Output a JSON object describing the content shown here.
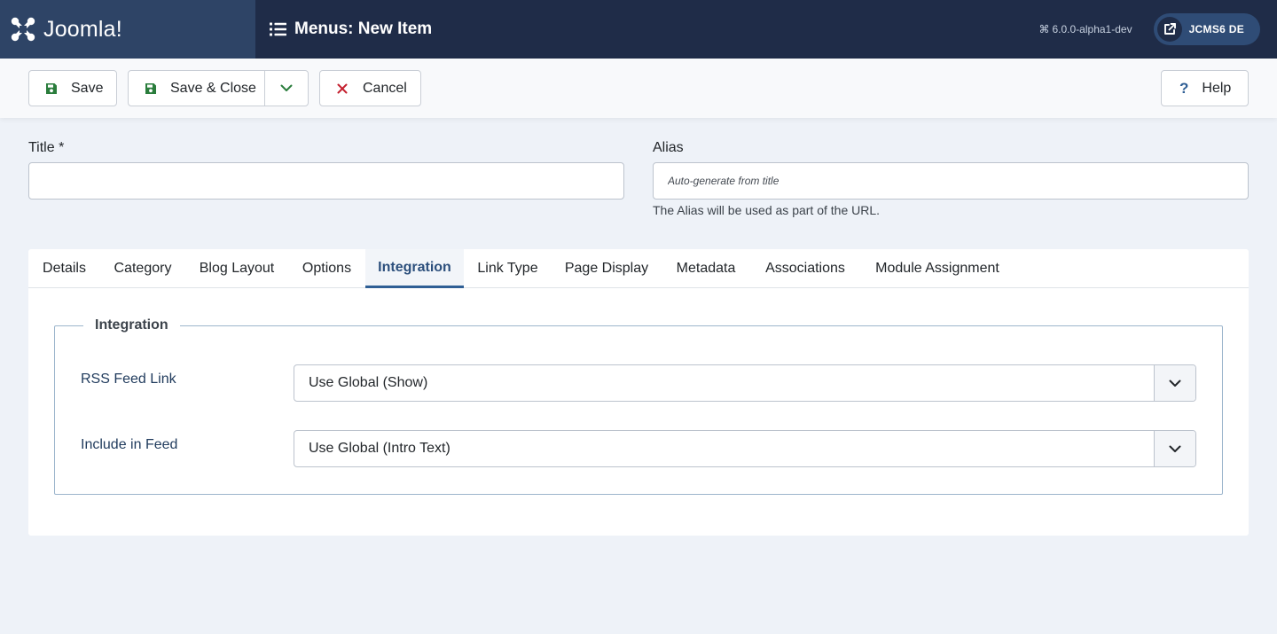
{
  "header": {
    "brand": "Joomla!",
    "page_title": "Menus: New Item",
    "version": "6.0.0-alpha1-dev",
    "site_label": "JCMS6 DE"
  },
  "toolbar": {
    "save": "Save",
    "save_close": "Save & Close",
    "cancel": "Cancel",
    "help": "Help"
  },
  "form": {
    "title_label": "Title *",
    "title_value": "",
    "alias_label": "Alias",
    "alias_placeholder": "Auto-generate from title",
    "alias_hint": "The Alias will be used as part of the URL."
  },
  "tabs": [
    {
      "label": "Details"
    },
    {
      "label": "Category"
    },
    {
      "label": "Blog Layout"
    },
    {
      "label": "Options"
    },
    {
      "label": "Integration",
      "active": true
    },
    {
      "label": "Link Type"
    },
    {
      "label": "Page Display"
    },
    {
      "label": "Metadata"
    },
    {
      "label": "Associations"
    },
    {
      "label": "Module Assignment"
    }
  ],
  "integration": {
    "legend": "Integration",
    "rss_label": "RSS Feed Link",
    "rss_value": "Use Global (Show)",
    "feed_label": "Include in Feed",
    "feed_value": "Use Global (Intro Text)"
  },
  "colors": {
    "header_bg": "#1f2c48",
    "brand_bg": "#2e4466",
    "save_icon": "#2a7d3c",
    "cancel_icon": "#c4202f",
    "help_icon": "#2f5f95",
    "active_tab": "#2f5f95"
  }
}
